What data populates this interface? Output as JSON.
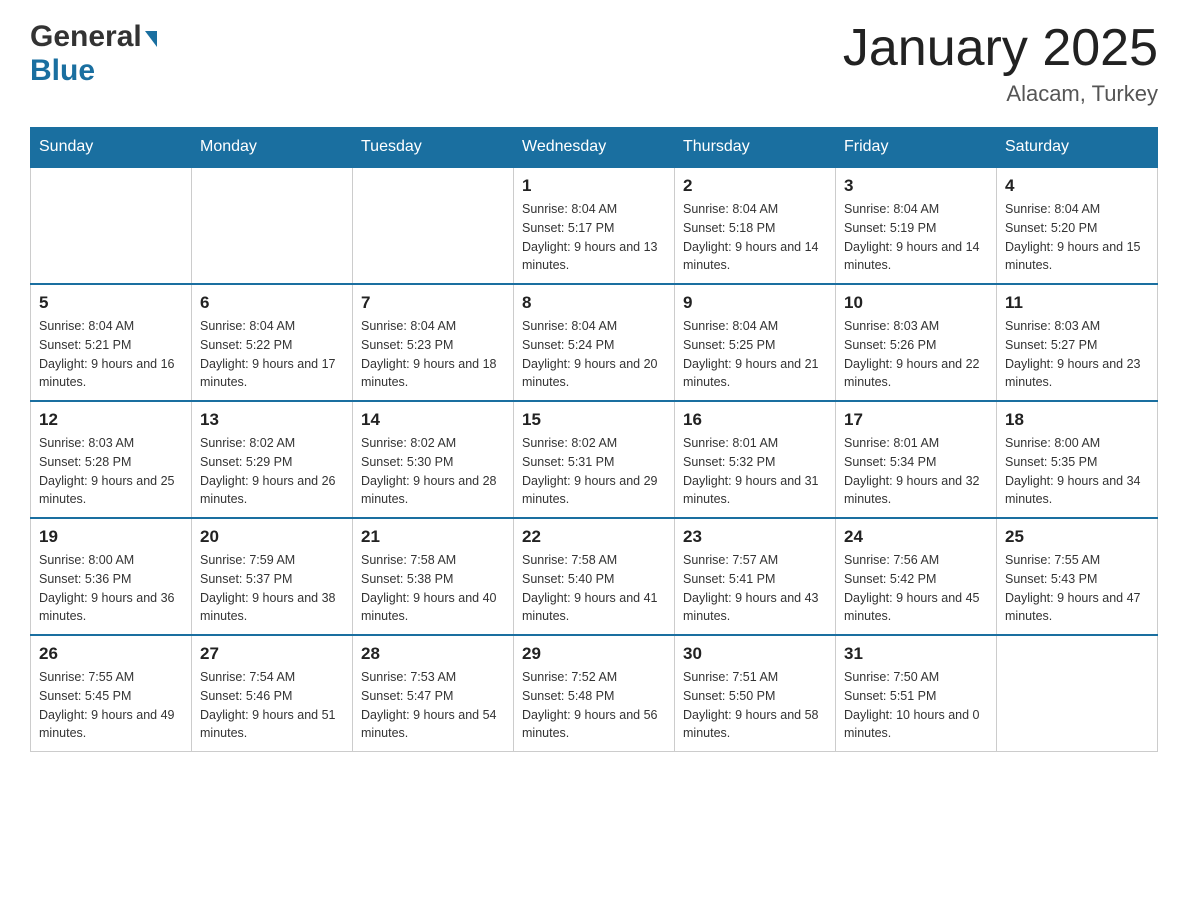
{
  "header": {
    "logo_general": "General",
    "logo_blue": "Blue",
    "title": "January 2025",
    "subtitle": "Alacam, Turkey"
  },
  "days_of_week": [
    "Sunday",
    "Monday",
    "Tuesday",
    "Wednesday",
    "Thursday",
    "Friday",
    "Saturday"
  ],
  "weeks": [
    [
      {
        "day": "",
        "sunrise": "",
        "sunset": "",
        "daylight": ""
      },
      {
        "day": "",
        "sunrise": "",
        "sunset": "",
        "daylight": ""
      },
      {
        "day": "",
        "sunrise": "",
        "sunset": "",
        "daylight": ""
      },
      {
        "day": "1",
        "sunrise": "Sunrise: 8:04 AM",
        "sunset": "Sunset: 5:17 PM",
        "daylight": "Daylight: 9 hours and 13 minutes."
      },
      {
        "day": "2",
        "sunrise": "Sunrise: 8:04 AM",
        "sunset": "Sunset: 5:18 PM",
        "daylight": "Daylight: 9 hours and 14 minutes."
      },
      {
        "day": "3",
        "sunrise": "Sunrise: 8:04 AM",
        "sunset": "Sunset: 5:19 PM",
        "daylight": "Daylight: 9 hours and 14 minutes."
      },
      {
        "day": "4",
        "sunrise": "Sunrise: 8:04 AM",
        "sunset": "Sunset: 5:20 PM",
        "daylight": "Daylight: 9 hours and 15 minutes."
      }
    ],
    [
      {
        "day": "5",
        "sunrise": "Sunrise: 8:04 AM",
        "sunset": "Sunset: 5:21 PM",
        "daylight": "Daylight: 9 hours and 16 minutes."
      },
      {
        "day": "6",
        "sunrise": "Sunrise: 8:04 AM",
        "sunset": "Sunset: 5:22 PM",
        "daylight": "Daylight: 9 hours and 17 minutes."
      },
      {
        "day": "7",
        "sunrise": "Sunrise: 8:04 AM",
        "sunset": "Sunset: 5:23 PM",
        "daylight": "Daylight: 9 hours and 18 minutes."
      },
      {
        "day": "8",
        "sunrise": "Sunrise: 8:04 AM",
        "sunset": "Sunset: 5:24 PM",
        "daylight": "Daylight: 9 hours and 20 minutes."
      },
      {
        "day": "9",
        "sunrise": "Sunrise: 8:04 AM",
        "sunset": "Sunset: 5:25 PM",
        "daylight": "Daylight: 9 hours and 21 minutes."
      },
      {
        "day": "10",
        "sunrise": "Sunrise: 8:03 AM",
        "sunset": "Sunset: 5:26 PM",
        "daylight": "Daylight: 9 hours and 22 minutes."
      },
      {
        "day": "11",
        "sunrise": "Sunrise: 8:03 AM",
        "sunset": "Sunset: 5:27 PM",
        "daylight": "Daylight: 9 hours and 23 minutes."
      }
    ],
    [
      {
        "day": "12",
        "sunrise": "Sunrise: 8:03 AM",
        "sunset": "Sunset: 5:28 PM",
        "daylight": "Daylight: 9 hours and 25 minutes."
      },
      {
        "day": "13",
        "sunrise": "Sunrise: 8:02 AM",
        "sunset": "Sunset: 5:29 PM",
        "daylight": "Daylight: 9 hours and 26 minutes."
      },
      {
        "day": "14",
        "sunrise": "Sunrise: 8:02 AM",
        "sunset": "Sunset: 5:30 PM",
        "daylight": "Daylight: 9 hours and 28 minutes."
      },
      {
        "day": "15",
        "sunrise": "Sunrise: 8:02 AM",
        "sunset": "Sunset: 5:31 PM",
        "daylight": "Daylight: 9 hours and 29 minutes."
      },
      {
        "day": "16",
        "sunrise": "Sunrise: 8:01 AM",
        "sunset": "Sunset: 5:32 PM",
        "daylight": "Daylight: 9 hours and 31 minutes."
      },
      {
        "day": "17",
        "sunrise": "Sunrise: 8:01 AM",
        "sunset": "Sunset: 5:34 PM",
        "daylight": "Daylight: 9 hours and 32 minutes."
      },
      {
        "day": "18",
        "sunrise": "Sunrise: 8:00 AM",
        "sunset": "Sunset: 5:35 PM",
        "daylight": "Daylight: 9 hours and 34 minutes."
      }
    ],
    [
      {
        "day": "19",
        "sunrise": "Sunrise: 8:00 AM",
        "sunset": "Sunset: 5:36 PM",
        "daylight": "Daylight: 9 hours and 36 minutes."
      },
      {
        "day": "20",
        "sunrise": "Sunrise: 7:59 AM",
        "sunset": "Sunset: 5:37 PM",
        "daylight": "Daylight: 9 hours and 38 minutes."
      },
      {
        "day": "21",
        "sunrise": "Sunrise: 7:58 AM",
        "sunset": "Sunset: 5:38 PM",
        "daylight": "Daylight: 9 hours and 40 minutes."
      },
      {
        "day": "22",
        "sunrise": "Sunrise: 7:58 AM",
        "sunset": "Sunset: 5:40 PM",
        "daylight": "Daylight: 9 hours and 41 minutes."
      },
      {
        "day": "23",
        "sunrise": "Sunrise: 7:57 AM",
        "sunset": "Sunset: 5:41 PM",
        "daylight": "Daylight: 9 hours and 43 minutes."
      },
      {
        "day": "24",
        "sunrise": "Sunrise: 7:56 AM",
        "sunset": "Sunset: 5:42 PM",
        "daylight": "Daylight: 9 hours and 45 minutes."
      },
      {
        "day": "25",
        "sunrise": "Sunrise: 7:55 AM",
        "sunset": "Sunset: 5:43 PM",
        "daylight": "Daylight: 9 hours and 47 minutes."
      }
    ],
    [
      {
        "day": "26",
        "sunrise": "Sunrise: 7:55 AM",
        "sunset": "Sunset: 5:45 PM",
        "daylight": "Daylight: 9 hours and 49 minutes."
      },
      {
        "day": "27",
        "sunrise": "Sunrise: 7:54 AM",
        "sunset": "Sunset: 5:46 PM",
        "daylight": "Daylight: 9 hours and 51 minutes."
      },
      {
        "day": "28",
        "sunrise": "Sunrise: 7:53 AM",
        "sunset": "Sunset: 5:47 PM",
        "daylight": "Daylight: 9 hours and 54 minutes."
      },
      {
        "day": "29",
        "sunrise": "Sunrise: 7:52 AM",
        "sunset": "Sunset: 5:48 PM",
        "daylight": "Daylight: 9 hours and 56 minutes."
      },
      {
        "day": "30",
        "sunrise": "Sunrise: 7:51 AM",
        "sunset": "Sunset: 5:50 PM",
        "daylight": "Daylight: 9 hours and 58 minutes."
      },
      {
        "day": "31",
        "sunrise": "Sunrise: 7:50 AM",
        "sunset": "Sunset: 5:51 PM",
        "daylight": "Daylight: 10 hours and 0 minutes."
      },
      {
        "day": "",
        "sunrise": "",
        "sunset": "",
        "daylight": ""
      }
    ]
  ]
}
